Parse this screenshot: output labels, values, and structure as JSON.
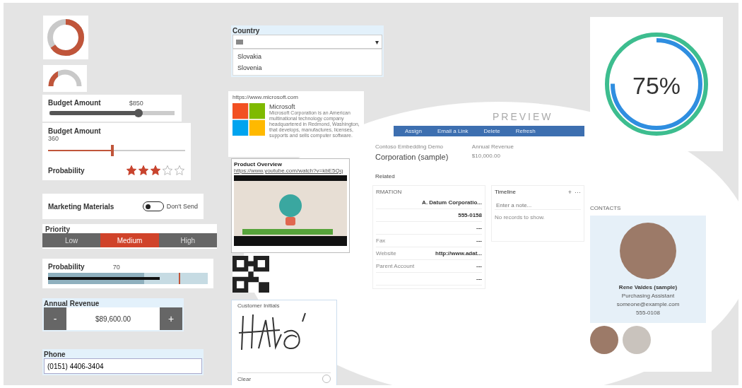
{
  "donut_gauge": {
    "level": 0.65
  },
  "half_gauge": {
    "level": 0.3
  },
  "slider": {
    "label": "Budget Amount",
    "reading": "$850",
    "level": 0.71
  },
  "linear_slider": {
    "label": "Budget Amount",
    "reading": "360",
    "level": 0.47
  },
  "rating": {
    "label": "Probability",
    "stars": 3
  },
  "toggle": {
    "label": "Marketing Materials",
    "on": false,
    "text": "Don't Send"
  },
  "priority": {
    "label": "Priority",
    "options": [
      {
        "label": "Low",
        "selected": false
      },
      {
        "label": "Medium",
        "selected": true
      },
      {
        "label": "High",
        "selected": false
      }
    ]
  },
  "bullet": {
    "label": "Probability",
    "reading": "70",
    "level": 0.7
  },
  "number_input": {
    "label": "Annual Revenue",
    "value": "$89,600.00",
    "decrement": "-",
    "increment": "+"
  },
  "phone": {
    "label": "Phone",
    "value": "(0151) 4406-3404"
  },
  "country": {
    "label": "Country",
    "arrow": "▾",
    "options": [
      "Slovakia",
      "Slovenia"
    ]
  },
  "link_preview": {
    "url": "https://www.microsoft.com",
    "title": "Microsoft",
    "description": "Microsoft Corporation is an American multinational technology company headquartered in Redmond, Washington, that develops, manufactures, licenses, supports and sells computer software."
  },
  "video": {
    "title": "Product Overview",
    "url": "https://www.youtube.com/watch?v=kbE5Qq"
  },
  "signature": {
    "label": "Customer Initials",
    "clear": "Clear"
  },
  "progress": {
    "reading": "75%",
    "level": 0.75
  },
  "form": {
    "watermark": "PREVIEW",
    "toolbar": [
      "Assign",
      "Email a Link",
      "Delete",
      "Refresh"
    ],
    "breadcrumb": "Contoso Embedding Demo",
    "title": "Corporation (sample)",
    "header_label": "Annual Revenue",
    "header_value": "$10,000.00",
    "tab": "Related",
    "section": "RMATION",
    "fields": [
      {
        "value": "A. Datum Corporatio..."
      },
      {
        "value": "555-0158"
      },
      {
        "value": "---"
      },
      {
        "label": "Fax",
        "value": "---"
      },
      {
        "label": "Website",
        "value": "http://www.adat..."
      },
      {
        "label": "Parent Account",
        "value": "---"
      },
      {
        "value": "---"
      }
    ],
    "timeline": {
      "title": "Timeline",
      "add": "+",
      "more": "···",
      "placeholder": "Enter a note...",
      "empty": "No records to show."
    },
    "contacts": {
      "title": "CONTACTS",
      "name": "Rene Valdes (sample)",
      "role": "Purchasing Assistant",
      "email": "someone@example.com",
      "phone": "555-0108"
    }
  }
}
